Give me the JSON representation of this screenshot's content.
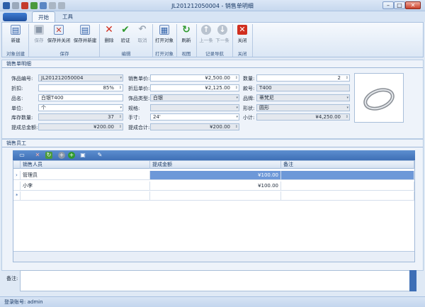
{
  "window": {
    "title": "JL201212050004 - 销售单明细"
  },
  "ribbon": {
    "tabs": [
      "开始",
      "工具"
    ],
    "buttons": {
      "new": "新建",
      "save": "保存",
      "save_close": "保存并关闭",
      "save_new": "保存并新建",
      "delete": "删除",
      "verify": "验证",
      "cancel": "取消",
      "open_object": "打开对象",
      "refresh": "刷新",
      "prev": "上一条",
      "next": "下一条",
      "close": "关闭"
    },
    "groups": {
      "create": "对象创建",
      "save": "保存",
      "edit": "编辑",
      "open": "打开对象",
      "view": "视图",
      "nav": "记录导航",
      "close": "关闭"
    }
  },
  "detail": {
    "section_title": "销售单明细",
    "labels": {
      "code": "饰品编号:",
      "discount": "折扣:",
      "name": "品名:",
      "unit": "单位:",
      "stock": "库存数量:",
      "commission_total_amount": "提成总金额:",
      "sale_price": "销售单价:",
      "discount_price": "折后单价:",
      "type": "饰品类型:",
      "spec": "规格:",
      "size": "手寸:",
      "commission_total": "提成合计:",
      "quantity": "数量:",
      "model": "款号:",
      "brand": "品牌:",
      "shape": "形状:",
      "subtotal": "小计:"
    },
    "values": {
      "code": "JL201212050004",
      "discount": "85%",
      "name": "白银T400",
      "unit": "个",
      "stock": "37",
      "commission_total_amount": "¥200.00",
      "sale_price": "¥2,500.00",
      "discount_price": "¥2,125.00",
      "type": "白银",
      "spec": "",
      "size": "24'",
      "commission_total": "¥200.00",
      "quantity": "2",
      "model": "T400",
      "brand": "蒂梵尼",
      "shape": "圆形",
      "subtotal": "¥4,250.00"
    }
  },
  "sales": {
    "section_title": "销售员工",
    "columns": [
      "销售人员",
      "提成金额",
      "备注"
    ],
    "rows": [
      {
        "person": "管理员",
        "amount": "¥100.00",
        "note": ""
      },
      {
        "person": "小李",
        "amount": "¥100.00",
        "note": ""
      }
    ]
  },
  "note": {
    "label": "备注:"
  },
  "status": {
    "text": "登录账号: admin"
  }
}
